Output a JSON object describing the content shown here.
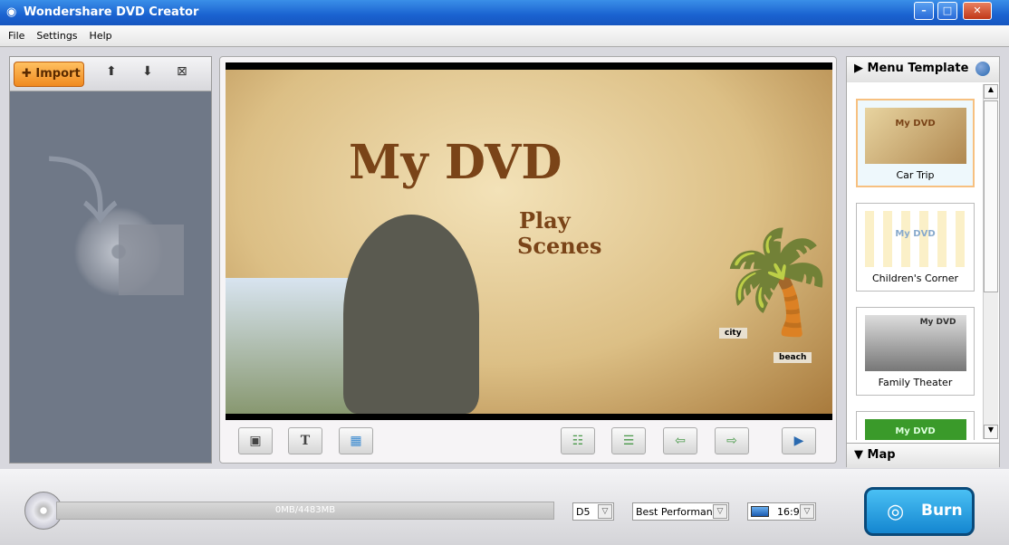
{
  "window": {
    "title": "Wondershare DVD Creator",
    "controls": [
      "minimize",
      "maximize",
      "close"
    ]
  },
  "menu": [
    "File",
    "Settings",
    "Help"
  ],
  "left_toolbar": {
    "import_label": "Import"
  },
  "preview": {
    "title": "My DVD",
    "subtitle_line1": "Play",
    "subtitle_line2": "Scenes",
    "sign1": "city",
    "sign2": "beach"
  },
  "right_panel": {
    "menu_template_label": "Menu Template",
    "map_label": "Map",
    "templates": [
      {
        "name": "Car Trip",
        "selected": true
      },
      {
        "name": "Children's Corner"
      },
      {
        "name": "Family Theater"
      },
      {
        "name": "My DVD"
      }
    ]
  },
  "bottom": {
    "capacity_text": "0MB/4483MB",
    "capacity_fraction": 0,
    "disc_type": "D5",
    "quality": "Best Performance",
    "aspect": "16:9",
    "burn_label": "Burn"
  }
}
